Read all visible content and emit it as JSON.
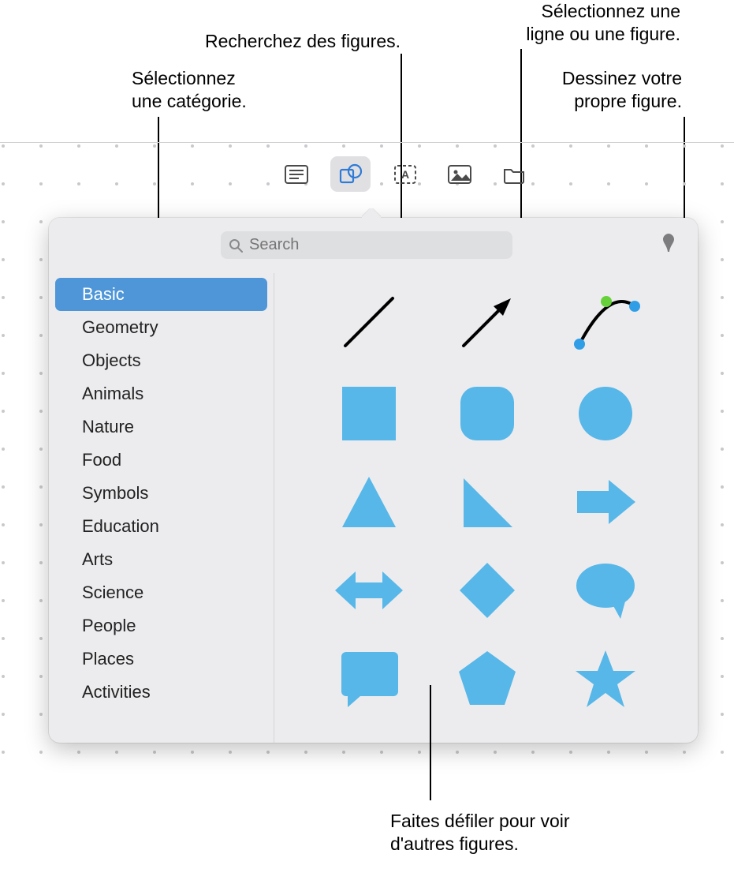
{
  "callouts": {
    "select_category": "Sélectionnez\nune catégorie.",
    "search_shapes": "Recherchez des figures.",
    "select_line_shape": "Sélectionnez une\nligne ou une figure.",
    "draw_own": "Dessinez votre\npropre figure.",
    "scroll_more": "Faites défiler pour voir\nd'autres figures."
  },
  "toolbar": {
    "items": [
      {
        "name": "text-layout-icon"
      },
      {
        "name": "shapes-icon"
      },
      {
        "name": "text-box-icon"
      },
      {
        "name": "media-icon"
      },
      {
        "name": "folder-icon"
      }
    ],
    "active_index": 1
  },
  "search": {
    "placeholder": "Search",
    "value": ""
  },
  "pen_tool": {
    "name": "pen-icon"
  },
  "sidebar": {
    "items": [
      {
        "label": "Basic",
        "selected": true
      },
      {
        "label": "Geometry"
      },
      {
        "label": "Objects"
      },
      {
        "label": "Animals"
      },
      {
        "label": "Nature"
      },
      {
        "label": "Food"
      },
      {
        "label": "Symbols"
      },
      {
        "label": "Education"
      },
      {
        "label": "Arts"
      },
      {
        "label": "Science"
      },
      {
        "label": "People"
      },
      {
        "label": "Places"
      },
      {
        "label": "Activities"
      }
    ]
  },
  "shapes_grid": {
    "columns": 3,
    "items": [
      {
        "name": "line"
      },
      {
        "name": "arrow-line"
      },
      {
        "name": "curve"
      },
      {
        "name": "square"
      },
      {
        "name": "rounded-square"
      },
      {
        "name": "circle"
      },
      {
        "name": "triangle"
      },
      {
        "name": "right-triangle"
      },
      {
        "name": "right-arrow"
      },
      {
        "name": "double-arrow"
      },
      {
        "name": "diamond"
      },
      {
        "name": "speech-bubble"
      },
      {
        "name": "quote-bubble"
      },
      {
        "name": "pentagon"
      },
      {
        "name": "star"
      }
    ]
  },
  "colors": {
    "shape_blue": "#57b7e8",
    "selection_blue": "#4e96d8",
    "popover_bg": "#ececee"
  }
}
